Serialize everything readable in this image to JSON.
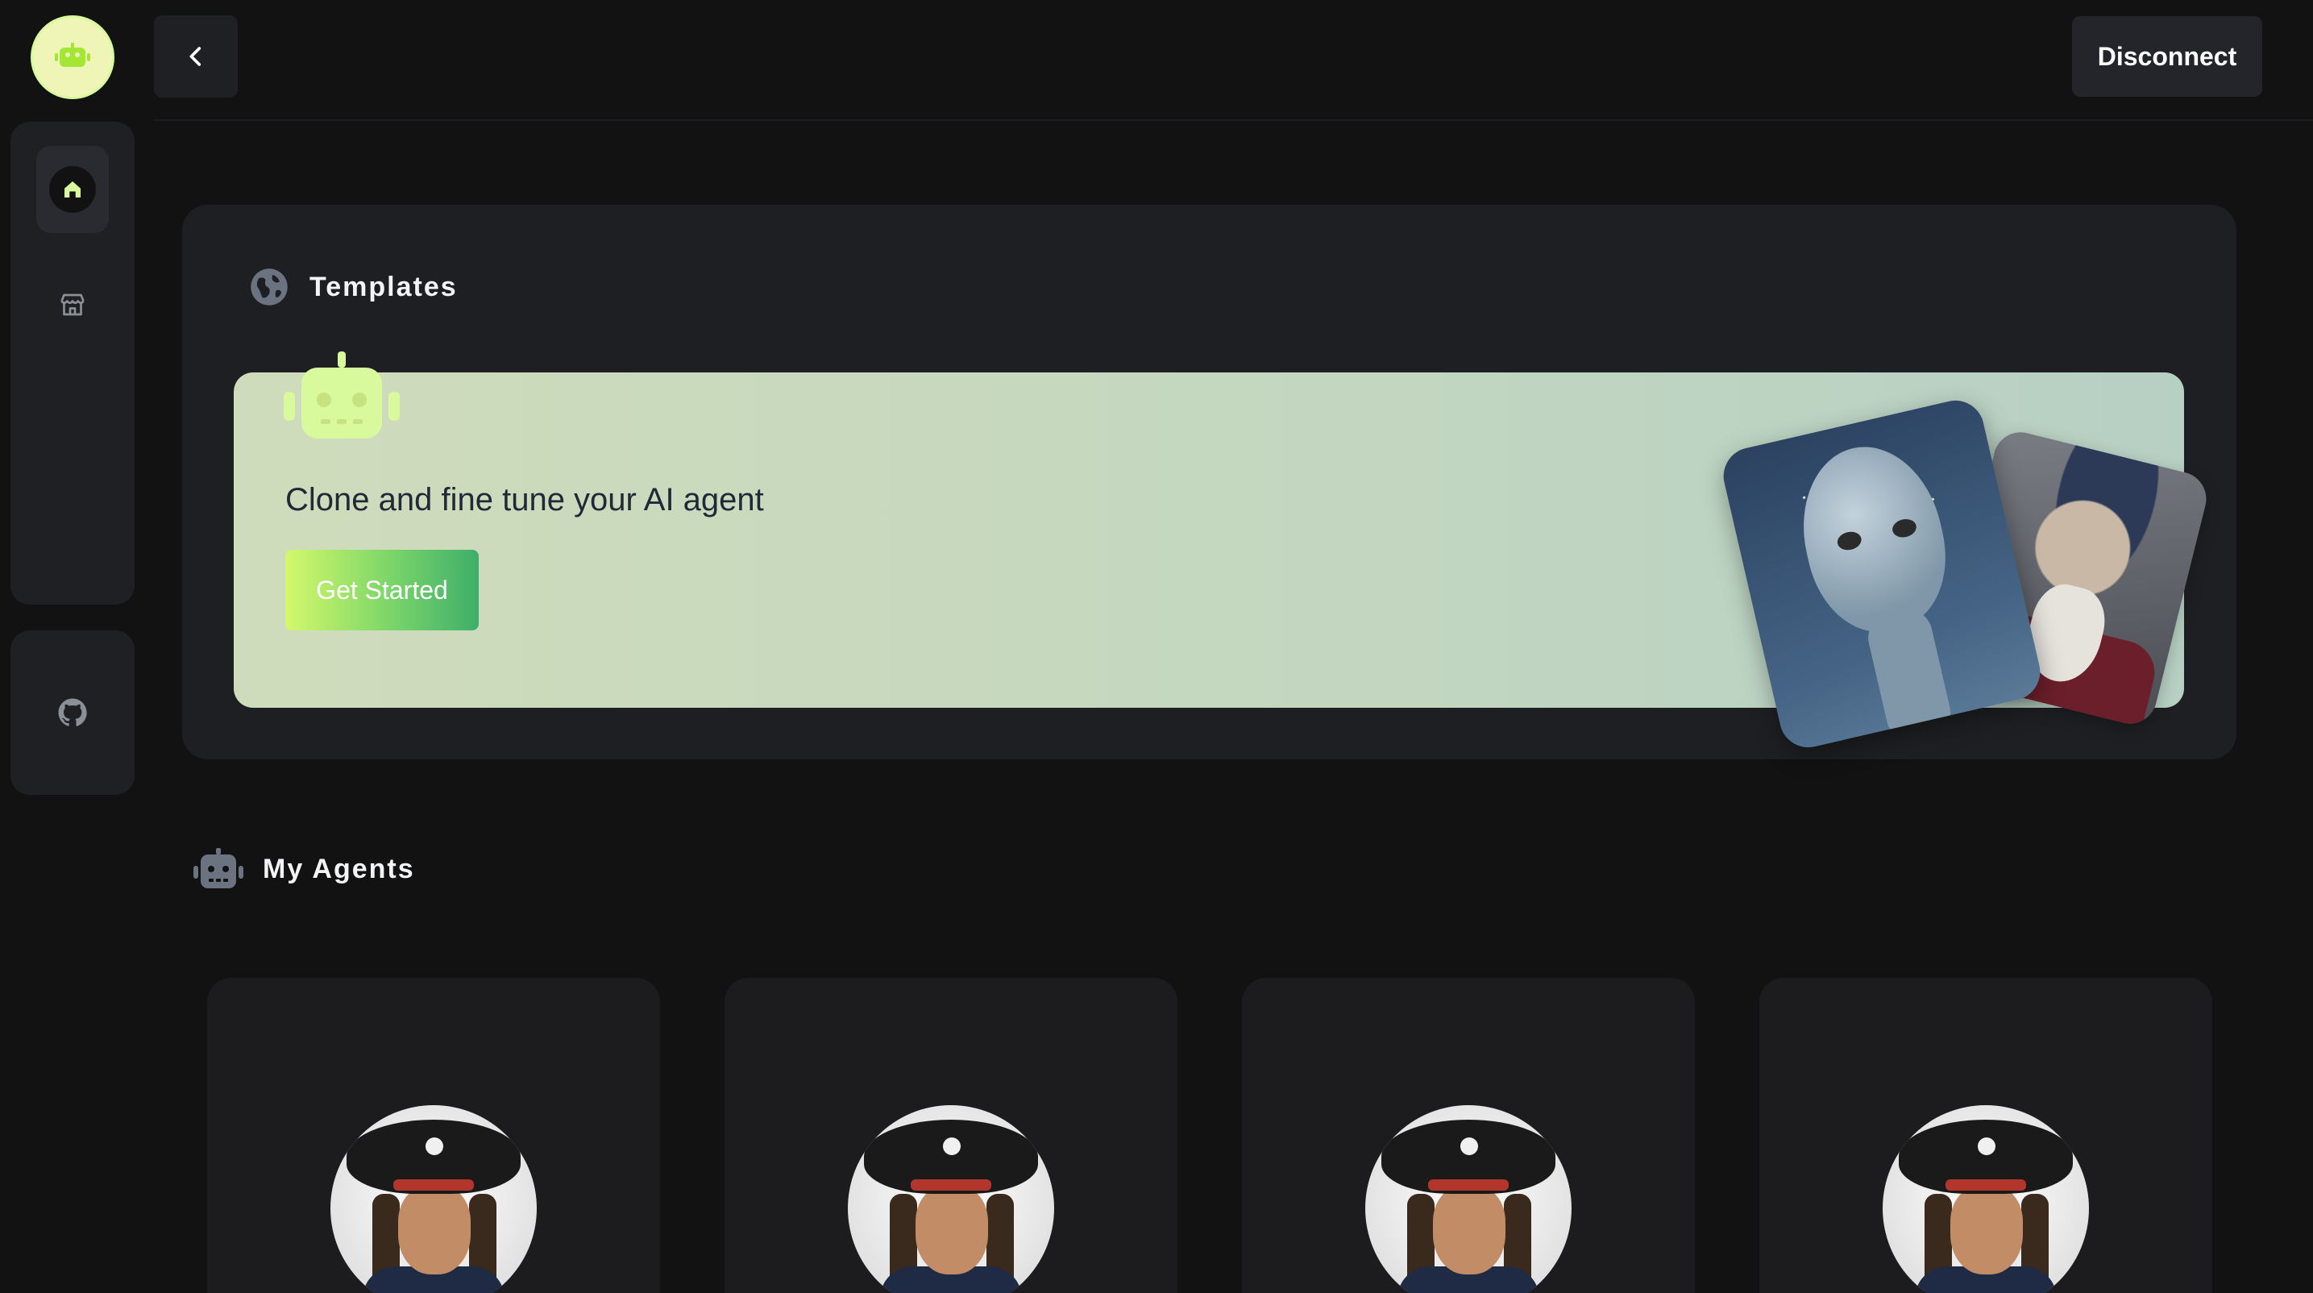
{
  "header": {
    "disconnect_label": "Disconnect"
  },
  "sidebar": {
    "items": [
      {
        "icon": "home-icon",
        "active": true
      },
      {
        "icon": "store-icon",
        "active": false
      }
    ],
    "footer_icon": "github-icon"
  },
  "templates": {
    "title": "Templates",
    "banner": {
      "headline": "Clone and fine tune your AI agent",
      "cta_label": "Get Started"
    }
  },
  "agents": {
    "title": "My Agents",
    "cards": [
      {
        "avatar": "pirate-avatar"
      },
      {
        "avatar": "pirate-avatar"
      },
      {
        "avatar": "pirate-avatar"
      },
      {
        "avatar": "pirate-avatar"
      }
    ]
  },
  "colors": {
    "background": "#121213",
    "panel": "#1e1f22",
    "accent": "#d9f99d",
    "banner_start": "#cfdcbb",
    "banner_end": "#b7d0c4"
  }
}
